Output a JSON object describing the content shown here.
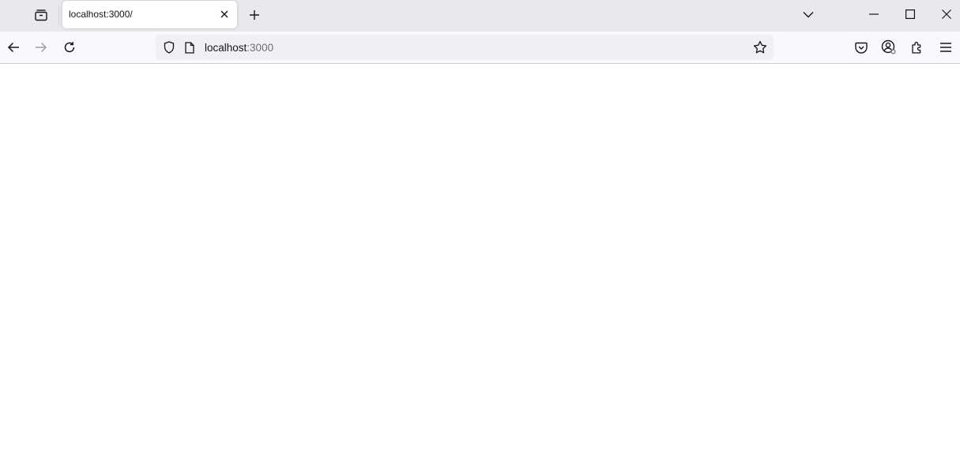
{
  "browser": {
    "tabs": [
      {
        "title": "localhost:3000/",
        "active": true
      }
    ],
    "url": {
      "host": "localhost",
      "port": ":3000"
    },
    "icons": {
      "collections": "tab-collections-icon",
      "close_tab": "close-icon",
      "new_tab": "plus-icon",
      "list_tabs": "chevron-down-icon",
      "minimize": "minimize-icon",
      "maximize": "maximize-icon",
      "close_window": "close-icon",
      "back": "arrow-left-icon",
      "forward": "arrow-right-icon",
      "reload": "reload-icon",
      "tracking_protection": "shield-icon",
      "page_info": "page-icon",
      "bookmark": "star-icon",
      "pocket": "pocket-icon",
      "account": "account-icon",
      "extensions": "puzzle-icon",
      "menu": "hamburger-menu-icon"
    },
    "colors": {
      "tabstrip_bg": "#e9e9ed",
      "toolbar_bg": "#f9f9fb",
      "urlbar_bg": "#f0f0f4",
      "text": "#15141a",
      "muted_text": "#6d6d75"
    }
  },
  "page": {
    "content": ""
  }
}
